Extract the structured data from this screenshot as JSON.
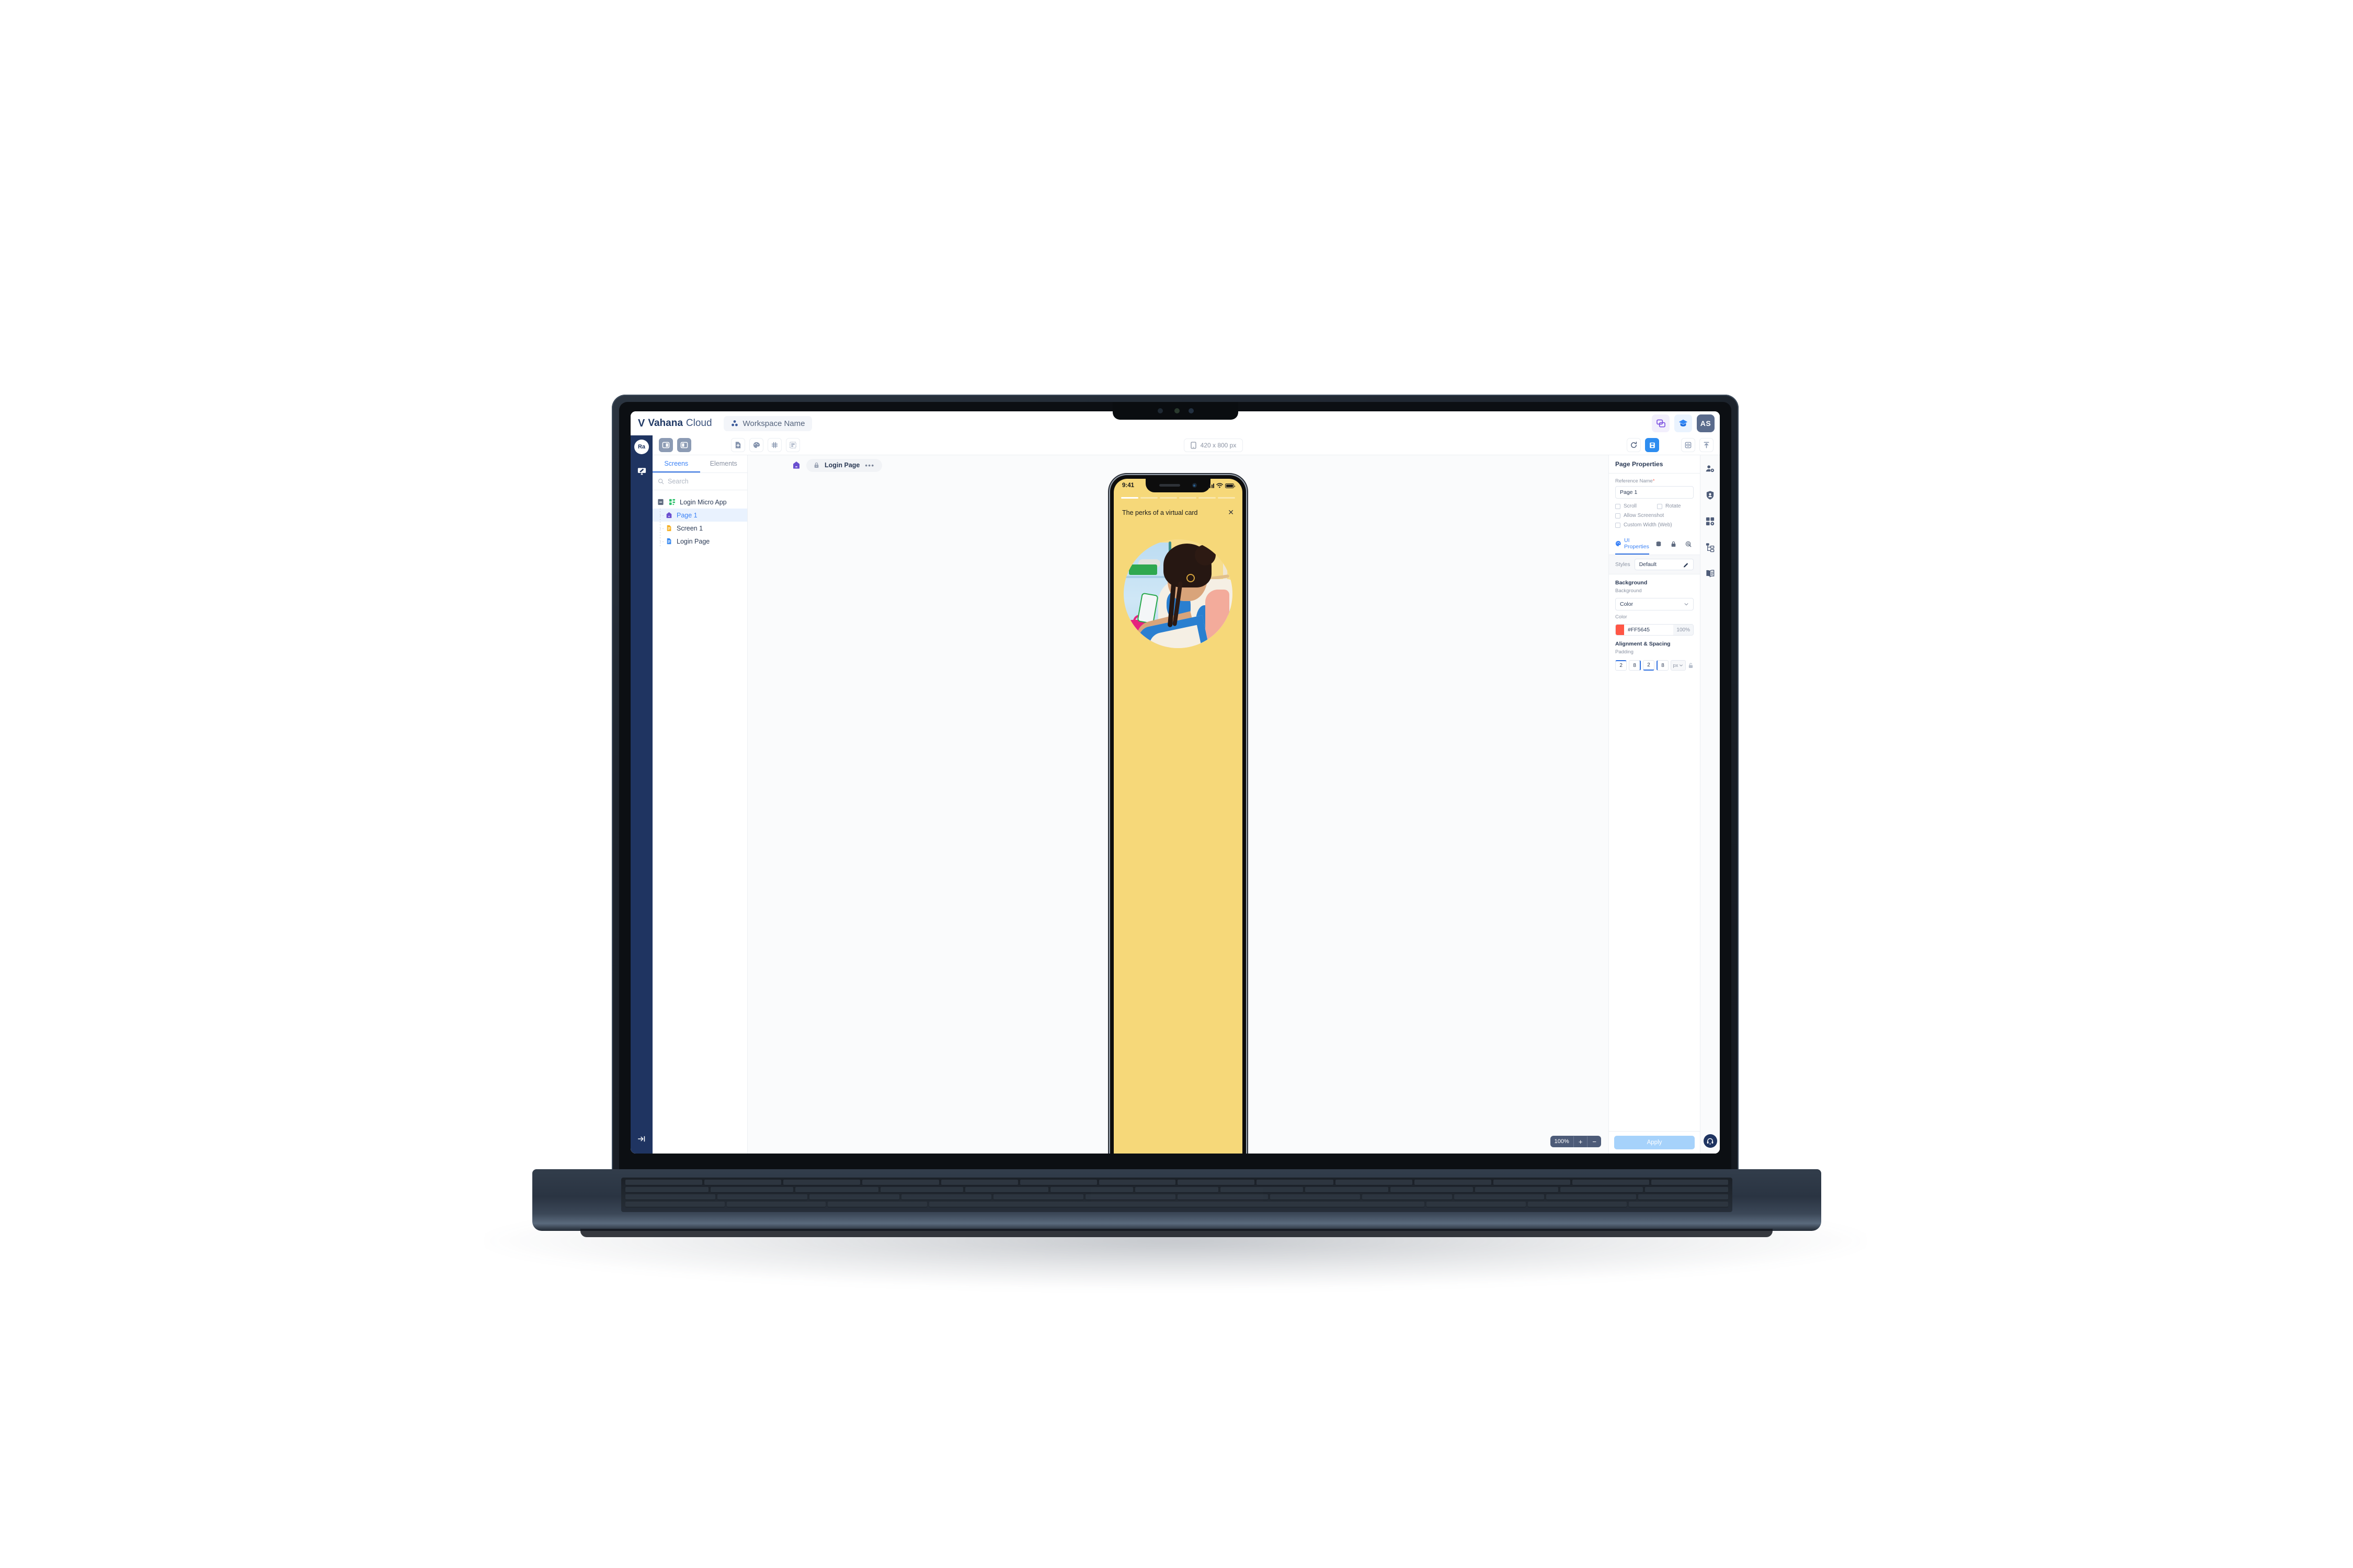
{
  "header": {
    "brand_v": "V",
    "brand_bold": "Vahana",
    "brand_light": "Cloud",
    "workspace": "Workspace Name",
    "avatar_initials": "AS",
    "icons": {
      "chat": "chat-bubbles-icon",
      "academy": "graduation-cap-icon"
    }
  },
  "left_rail": {
    "logo": "Ra",
    "design_icon": "design-monitor-icon",
    "expand_icon": "expand-panel-icon"
  },
  "toolbar": {
    "panel_left": "toggle-left-panel",
    "panel_right": "toggle-right-panel",
    "add_page": "add-page-icon",
    "theme": "palette-icon",
    "grid": "grid-icon",
    "layout": "layout-icon",
    "device_size": "420 x 800 px",
    "refresh": "refresh-icon",
    "save": "save-icon",
    "preview": "preview-eye-icon",
    "publish": "publish-upload-icon"
  },
  "screens_panel": {
    "tabs": [
      {
        "label": "Screens",
        "active": true
      },
      {
        "label": "Elements",
        "active": false
      }
    ],
    "search_placeholder": "Search",
    "tree": [
      {
        "label": "Login Micro App",
        "icon": "micro-app-icon",
        "level": 0,
        "selected": false
      },
      {
        "label": "Page 1",
        "icon": "home-page-icon",
        "level": 1,
        "selected": true
      },
      {
        "label": "Screen 1",
        "icon": "screen-file-icon",
        "level": 1,
        "selected": false
      },
      {
        "label": "Login Page",
        "icon": "page-file-icon",
        "level": 1,
        "selected": false
      }
    ]
  },
  "canvas": {
    "page_icon": "home-page-icon",
    "lock_icon": "lock-icon",
    "page_name": "Login Page",
    "more": "•••",
    "zoom_level": "100%",
    "zoom_in": "+",
    "zoom_out": "−"
  },
  "phone": {
    "time": "9:41",
    "signal_icon": "cellular-signal-icon",
    "wifi_icon": "wifi-icon",
    "battery_icon": "battery-icon",
    "progress_steps": 6,
    "progress_active": 1,
    "title": "The perks of a virtual card",
    "close": "✕",
    "background_color": "#F6D879"
  },
  "properties": {
    "title": "Page Properties",
    "reference_name_label": "Reference Name",
    "required_mark": "*",
    "reference_name_value": "Page 1",
    "checkboxes": [
      {
        "label": "Scroll",
        "checked": false
      },
      {
        "label": "Rotate",
        "checked": false
      },
      {
        "label": "Allow Screenshot",
        "checked": false
      },
      {
        "label": "Custom Width (Web)",
        "checked": false
      }
    ],
    "tabs": [
      {
        "label": "UI Properties",
        "icon": "palette-icon",
        "active": true
      },
      {
        "label": "",
        "icon": "database-icon",
        "active": false
      },
      {
        "label": "",
        "icon": "lock-icon",
        "active": false
      },
      {
        "label": "",
        "icon": "action-target-icon",
        "active": false
      }
    ],
    "styles_label": "Styles",
    "styles_value": "Default",
    "styles_edit_icon": "pencil-icon",
    "background_section": "Background",
    "background_label": "Background",
    "background_value": "Color",
    "color_label": "Color",
    "color_hex": "#FF5645",
    "color_opacity": "100%",
    "color_swatch": "#FF5645",
    "spacing_section": "Alignment & Spacing",
    "padding_label": "Padding",
    "padding": [
      "2",
      "8",
      "2",
      "8"
    ],
    "padding_unit": "px",
    "lock_ratio_icon": "unlock-icon",
    "apply_label": "Apply"
  },
  "right_rail": {
    "items": [
      "user-settings-icon",
      "shield-user-icon",
      "apps-grid-settings-icon",
      "sitemap-icon",
      "book-icon"
    ],
    "support_icon": "headset-support-icon"
  }
}
